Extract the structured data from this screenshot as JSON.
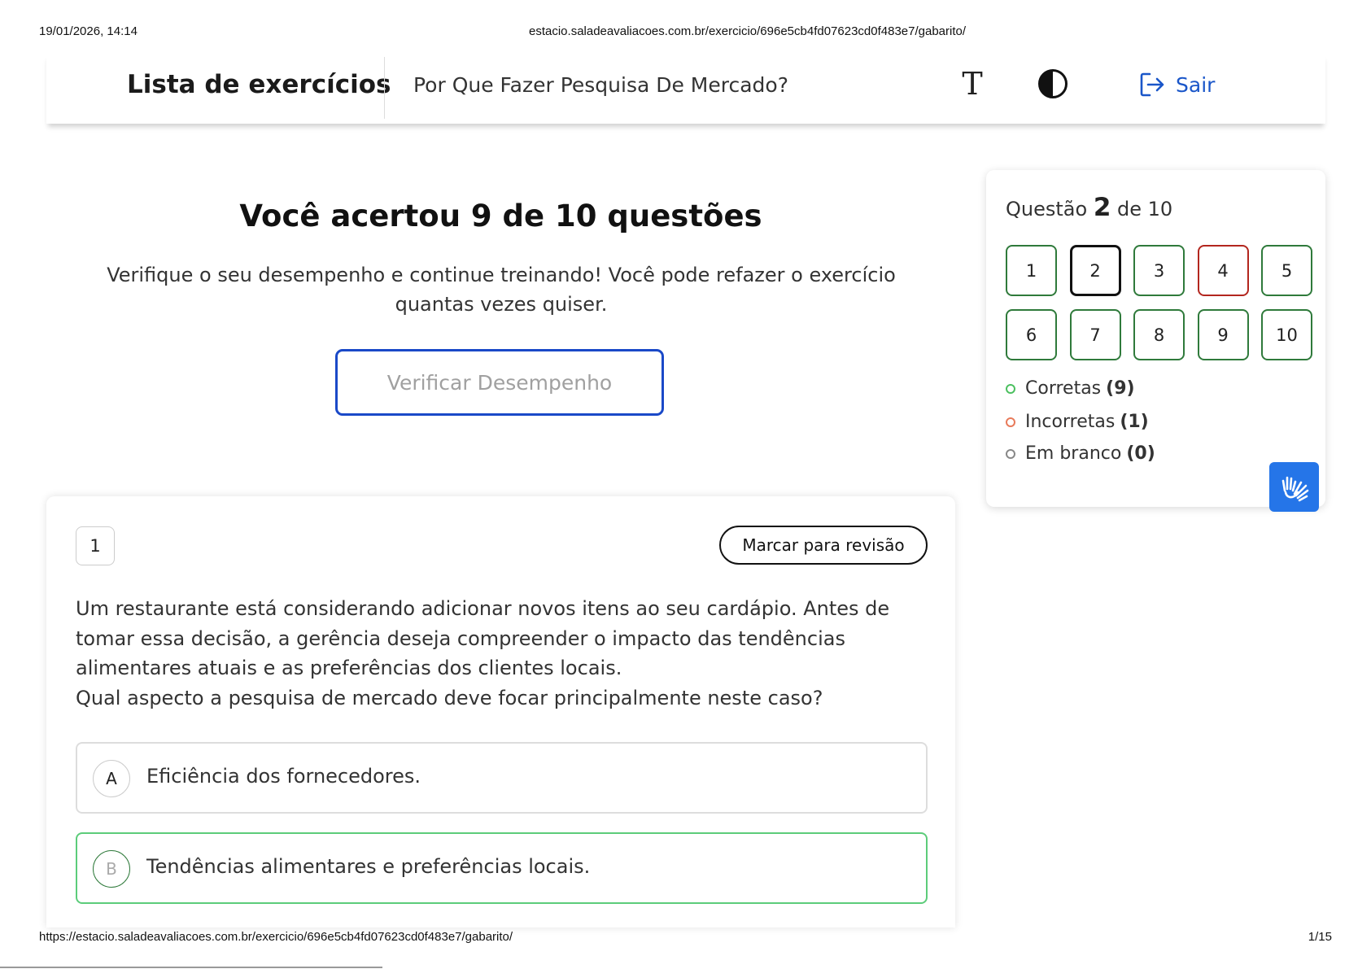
{
  "print": {
    "datetime": "19/01/2026, 14:14",
    "header_url": "estacio.saladeavaliacoes.com.br/exercicio/696e5cb4fd07623cd0f483e7/gabarito/",
    "footer_url": "https://estacio.saladeavaliacoes.com.br/exercicio/696e5cb4fd07623cd0f483e7/gabarito/",
    "page": "1/15"
  },
  "header": {
    "app_title": "Lista de exercícios",
    "exercise_title": "Por Que Fazer Pesquisa De Mercado?",
    "font_icon_glyph": "T",
    "logout_label": "Sair",
    "accent_color": "#1a56c9"
  },
  "result": {
    "title": "Você acertou 9 de 10 questões",
    "subtitle": "Verifique o seu desempenho e continue treinando! Você pode refazer o exercício quantas vezes quiser.",
    "button_label": "Verificar Desempenho"
  },
  "question": {
    "number": "1",
    "review_button": "Marcar para revisão",
    "text_lines": [
      "Um restaurante está considerando adicionar novos itens ao seu cardápio. Antes de tomar essa decisão, a gerência deseja compreender o impacto das tendências alimentares atuais e as preferências dos clientes locais.",
      "Qual aspecto a pesquisa de mercado deve focar principalmente neste caso?"
    ],
    "options": [
      {
        "letter": "A",
        "text": "Eficiência dos fornecedores.",
        "state": "neutral"
      },
      {
        "letter": "B",
        "text": "Tendências alimentares e preferências locais.",
        "state": "correct"
      }
    ]
  },
  "navigator": {
    "label_prefix": "Questão",
    "current": "2",
    "label_suffix": "de 10",
    "questions": [
      {
        "n": "1",
        "status": "correct"
      },
      {
        "n": "2",
        "status": "current"
      },
      {
        "n": "3",
        "status": "correct"
      },
      {
        "n": "4",
        "status": "wrong"
      },
      {
        "n": "5",
        "status": "correct"
      },
      {
        "n": "6",
        "status": "correct"
      },
      {
        "n": "7",
        "status": "correct"
      },
      {
        "n": "8",
        "status": "correct"
      },
      {
        "n": "9",
        "status": "correct"
      },
      {
        "n": "10",
        "status": "correct"
      }
    ],
    "legend": [
      {
        "label": "Corretas",
        "count": "(9)",
        "color": "#4cc060"
      },
      {
        "label": "Incorretas",
        "count": "(1)",
        "color": "#e87a5a"
      },
      {
        "label": "Em branco",
        "count": "(0)",
        "color": "#888888"
      }
    ]
  },
  "accessibility": {
    "icon": "sign-language-icon"
  }
}
